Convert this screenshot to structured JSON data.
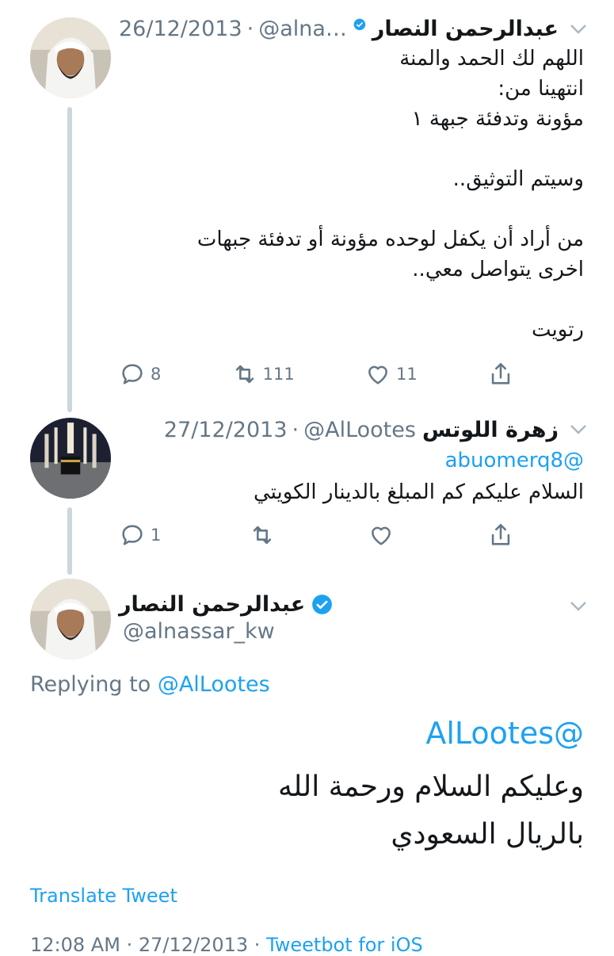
{
  "tweets": [
    {
      "name": "عبدالرحمن النصار",
      "handle": "@alna…",
      "date": "26/12/2013",
      "text": "اللهم لك الحمد والمنة\nانتهينا من:\nمؤونة وتدفئة جبهة ١\n\nوسيتم التوثيق..\n\nمن أراد أن يكفل لوحده مؤونة أو تدفئة جبهات\nاخرى يتواصل معي..\n\nرتويت",
      "replies": "8",
      "retweets": "111",
      "likes": "11"
    },
    {
      "name": "زهرة اللوتس",
      "handle": "@AlLootes",
      "date": "27/12/2013",
      "mention": "@abuomerq8",
      "text": "السلام عليكم كم المبلغ بالدينار الكويتي",
      "replies": "1"
    }
  ],
  "main": {
    "name": "عبدالرحمن النصار",
    "handle": "@alnassar_kw",
    "replying_prefix": "Replying to",
    "replying_to": "@AlLootes",
    "mention": "@AlLootes",
    "line1": "وعليكم السلام ورحمة الله",
    "line2": "بالريال السعودي",
    "translate": "Translate Tweet",
    "time": "12:08 AM",
    "date": "27/12/2013",
    "client": "Tweetbot for iOS"
  },
  "colors": {
    "accent": "#1da1f2",
    "muted": "#657786",
    "line": "#ccd6dd"
  },
  "icons": [
    "verified-badge-icon",
    "chevron-down-icon",
    "reply-icon",
    "retweet-icon",
    "like-icon",
    "share-icon"
  ]
}
